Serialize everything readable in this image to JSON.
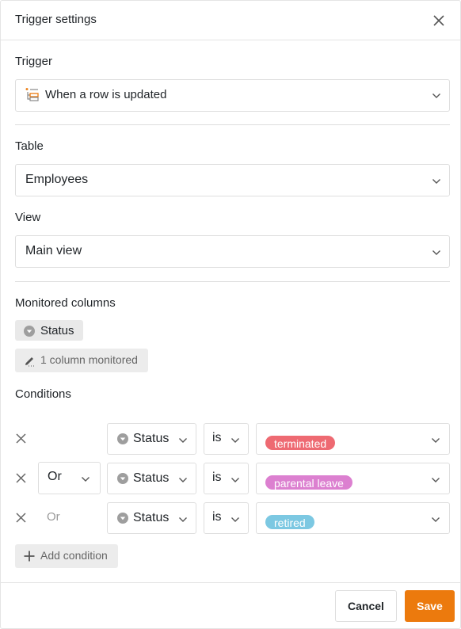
{
  "dialog": {
    "title": "Trigger settings"
  },
  "trigger": {
    "label": "Trigger",
    "value": "When a row is updated"
  },
  "table": {
    "label": "Table",
    "value": "Employees"
  },
  "view": {
    "label": "View",
    "value": "Main view"
  },
  "monitored": {
    "label": "Monitored columns",
    "chip": "Status",
    "button": "1 column monitored"
  },
  "conditions": {
    "label": "Conditions",
    "rows": [
      {
        "connector": "",
        "column": "Status",
        "operator": "is",
        "value": "terminated",
        "value_color": "#ee6a72"
      },
      {
        "connector": "Or",
        "column": "Status",
        "operator": "is",
        "value": "parental leave",
        "value_color": "#dc80d0"
      },
      {
        "connector": "Or",
        "column": "Status",
        "operator": "is",
        "value": "retired",
        "value_color": "#7cc8e2"
      }
    ],
    "add_label": "Add condition"
  },
  "footer": {
    "cancel_label": "Cancel",
    "save_label": "Save"
  },
  "colors": {
    "accent": "#ec7a0d",
    "border": "#dedede",
    "chip_bg": "#e9e9e9"
  },
  "icons": {
    "close": "close-icon",
    "trigger": "row-update-icon",
    "chevron": "chevron-down-icon",
    "single_select": "single-select-icon",
    "edit": "pencil-icon",
    "remove": "remove-x-icon",
    "add": "plus-icon"
  }
}
